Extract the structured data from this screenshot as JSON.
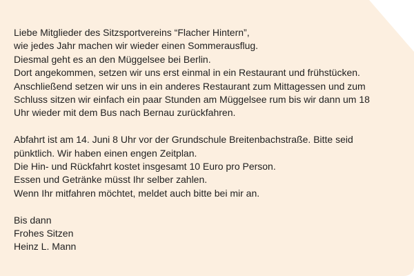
{
  "colors": {
    "card_background": "#fcefe0",
    "text": "#1f1f1f"
  },
  "paragraphs": [
    [
      "Liebe Mitglieder des Sitzsportvereins “Flacher Hintern”,",
      "wie jedes Jahr machen wir wieder einen Sommerausflug.",
      "Diesmal geht es an den Müggelsee bei Berlin.",
      "Dort angekommen, setzen wir uns erst einmal in ein Restaurant und frühstücken.",
      "Anschließend setzen wir uns in ein anderes Restaurant zum Mittagessen und zum",
      "Schluss sitzen wir einfach ein paar Stunden am Müggelsee rum bis wir dann um 18",
      "Uhr wieder mit dem Bus nach Bernau zurückfahren."
    ],
    [
      "Abfahrt ist am 14. Juni 8 Uhr vor der Grundschule Breitenbachstraße. Bitte seid",
      "pünktlich. Wir haben einen engen Zeitplan.",
      "Die Hin- und Rückfahrt kostet insgesamt 10 Euro pro Person.",
      "Essen und Getränke müsst Ihr selber zahlen.",
      "Wenn Ihr mitfahren möchtet, meldet auch bitte bei mir an."
    ],
    [
      "Bis dann",
      "Frohes Sitzen",
      "Heinz L. Mann"
    ]
  ]
}
